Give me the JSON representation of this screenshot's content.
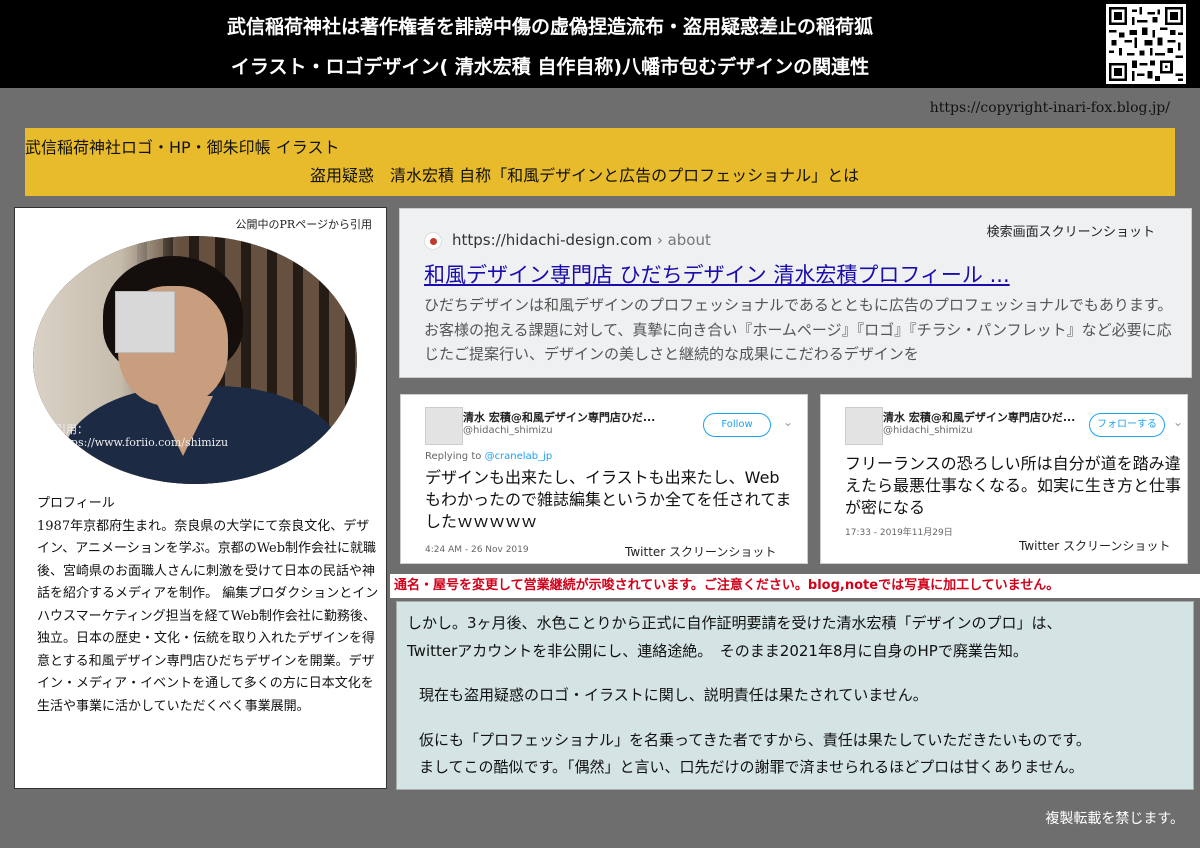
{
  "header": {
    "line1": "武信稲荷神社は著作権者を誹謗中傷の虚偽捏造流布・盗用疑惑差止の稲荷狐",
    "line2": "イラスト・ロゴデザイン( 清水宏積 自作自称)八幡市包むデザインの関連性"
  },
  "url": "https://copyright-inari-fox.blog.jp/",
  "banner": {
    "line1": "武信稲荷神社ロゴ・HP・御朱印帳 イラスト",
    "line2": "盗用疑惑　清水宏積 自称「和風デザインと広告のプロフェッショナル」とは"
  },
  "profile": {
    "cite": "公開中のPRページから引用",
    "photo_caption1": "引用：",
    "photo_caption2": "https://www.foriio.com/shimizu",
    "bio_heading": "プロフィール",
    "bio_text": "1987年京都府生まれ。奈良県の大学にて奈良文化、デザイン、アニメーションを学ぶ。京都のWeb制作会社に就職後、宮崎県のお面職人さんに刺激を受けて日本の民話や神話を紹介するメディアを制作。 編集プロダクションとインハウスマーケティング担当を経てWeb制作会社に勤務後、独立。日本の歴史・文化・伝統を取り入れたデザインを得意とする和風デザイン専門店ひだちデザインを開業。デザイン・メディア・イベントを通して多くの方に日本文化を生活や事業に活かしていただくべく事業展開。"
  },
  "search": {
    "label": "検索画面スクリーンショット",
    "url": "https://hidachi-design.com",
    "url_path": " › about",
    "title": "和風デザイン専門店 ひだちデザイン 清水宏積プロフィール ...",
    "desc": "ひだちデザインは和風デザインのプロフェッショナルであるとともに広告のプロフェッショナルでもあります。 お客様の抱える課題に対して、真摯に向き合い『ホームページ』『ロゴ』『チラシ・パンフレット』など必要に応じたご提案行い、デザインの美しさと継続的な成果にこだわるデザインを"
  },
  "tweets": [
    {
      "name": "清水 宏積@和風デザイン専門店ひだ...",
      "handle": "@hidachi_shimizu",
      "button": "Follow",
      "reply_prefix": "Replying to ",
      "reply_to": "@cranelab_jp",
      "body": "デザインも出来たし、イラストも出来たし、Webもわかったので雑誌編集というか全てを任されてましたｗｗｗｗｗ",
      "date": "4:24 AM - 26 Nov 2019",
      "shot": "Twitter スクリーンショット"
    },
    {
      "name": "清水 宏積@和風デザイン専門店ひだ...",
      "handle": "@hidachi_shimizu",
      "button": "フォローする",
      "body": "フリーランスの恐ろしい所は自分が道を踏み違えたら最悪仕事なくなる。如実に生き方と仕事が密になる",
      "date": "17:33 - 2019年11月29日",
      "shot": "Twitter スクリーンショット"
    }
  ],
  "warning": "通名・屋号を変更して営業継続が示唆されています。ご注意ください。blog,noteでは写真に加工していません。",
  "notice": {
    "p1": "しかし。3ヶ月後、水色ことりから正式に自作証明要請を受けた清水宏積「デザインのプロ」は、",
    "p2": "Twitterアカウントを非公開にし、連絡途絶。　そのまま2021年8月に自身のHPで廃業告知。",
    "p3": "現在も盗用疑惑のロゴ・イラストに関し、説明責任は果たされていません。",
    "p4": "仮にも「プロフェッショナル」を名乗ってきた者ですから、責任は果たしていただきたいものです。",
    "p5": "ましてこの酷似です。「偶然」と言い、口先だけの謝罪で済ませられるほどプロは甘くありません。"
  },
  "footer": "複製転載を禁じます。",
  "colors": {
    "header_bg": "#000000",
    "page_bg": "#6e6e6e",
    "banner_bg": "#e8bb2c",
    "warning_text": "#d0021b",
    "notice_bg": "#d4e3e3",
    "link": "#1a0dab",
    "twitter_blue": "#1da1f2"
  },
  "icons": [
    "qr-code-icon",
    "site-favicon-icon",
    "chevron-down-icon"
  ]
}
